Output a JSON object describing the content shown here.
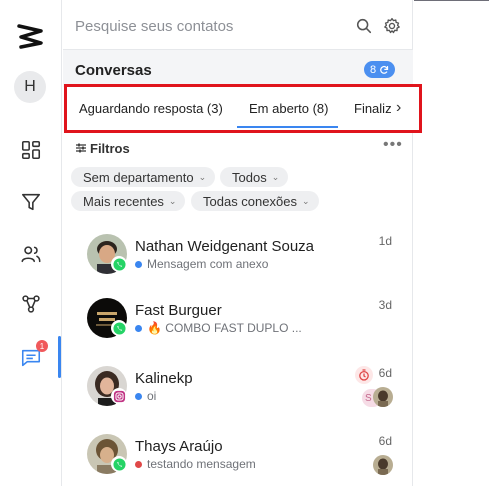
{
  "rail": {
    "avatar_initial": "H",
    "chat_badge": "1"
  },
  "search": {
    "placeholder": "Pesquise seus contatos"
  },
  "conversations": {
    "title": "Conversas",
    "count": "8"
  },
  "tabs": [
    {
      "label": "Aguardando resposta (3)",
      "active": false
    },
    {
      "label": "Em aberto (8)",
      "active": true
    },
    {
      "label": "Finaliz",
      "active": false
    }
  ],
  "filters": {
    "label": "Filtros",
    "chips": [
      {
        "label": "Sem departamento"
      },
      {
        "label": "Todos"
      },
      {
        "label": "Mais recentes"
      },
      {
        "label": "Todas conexões"
      }
    ]
  },
  "contacts": [
    {
      "name": "Nathan Weidgenant Souza",
      "message": "Mensagem com anexo",
      "time": "1d",
      "channel": "whatsapp",
      "status_color": "#3a86f0"
    },
    {
      "name": "Fast Burguer",
      "message": "🔥 COMBO FAST DUPLO ...",
      "time": "3d",
      "channel": "whatsapp",
      "status_color": "#3a86f0"
    },
    {
      "name": "Kalinekp",
      "message": "oi",
      "time": "6d",
      "channel": "instagram",
      "status_color": "#3a86f0"
    },
    {
      "name": "Thays Araújo",
      "message": "testando mensagem",
      "time": "6d",
      "channel": "whatsapp",
      "status_color": "#e04848"
    }
  ],
  "colors": {
    "accent": "#3a86f0",
    "whatsapp": "#25d366",
    "instagram": "#c13584",
    "highlight": "#e0141c"
  }
}
